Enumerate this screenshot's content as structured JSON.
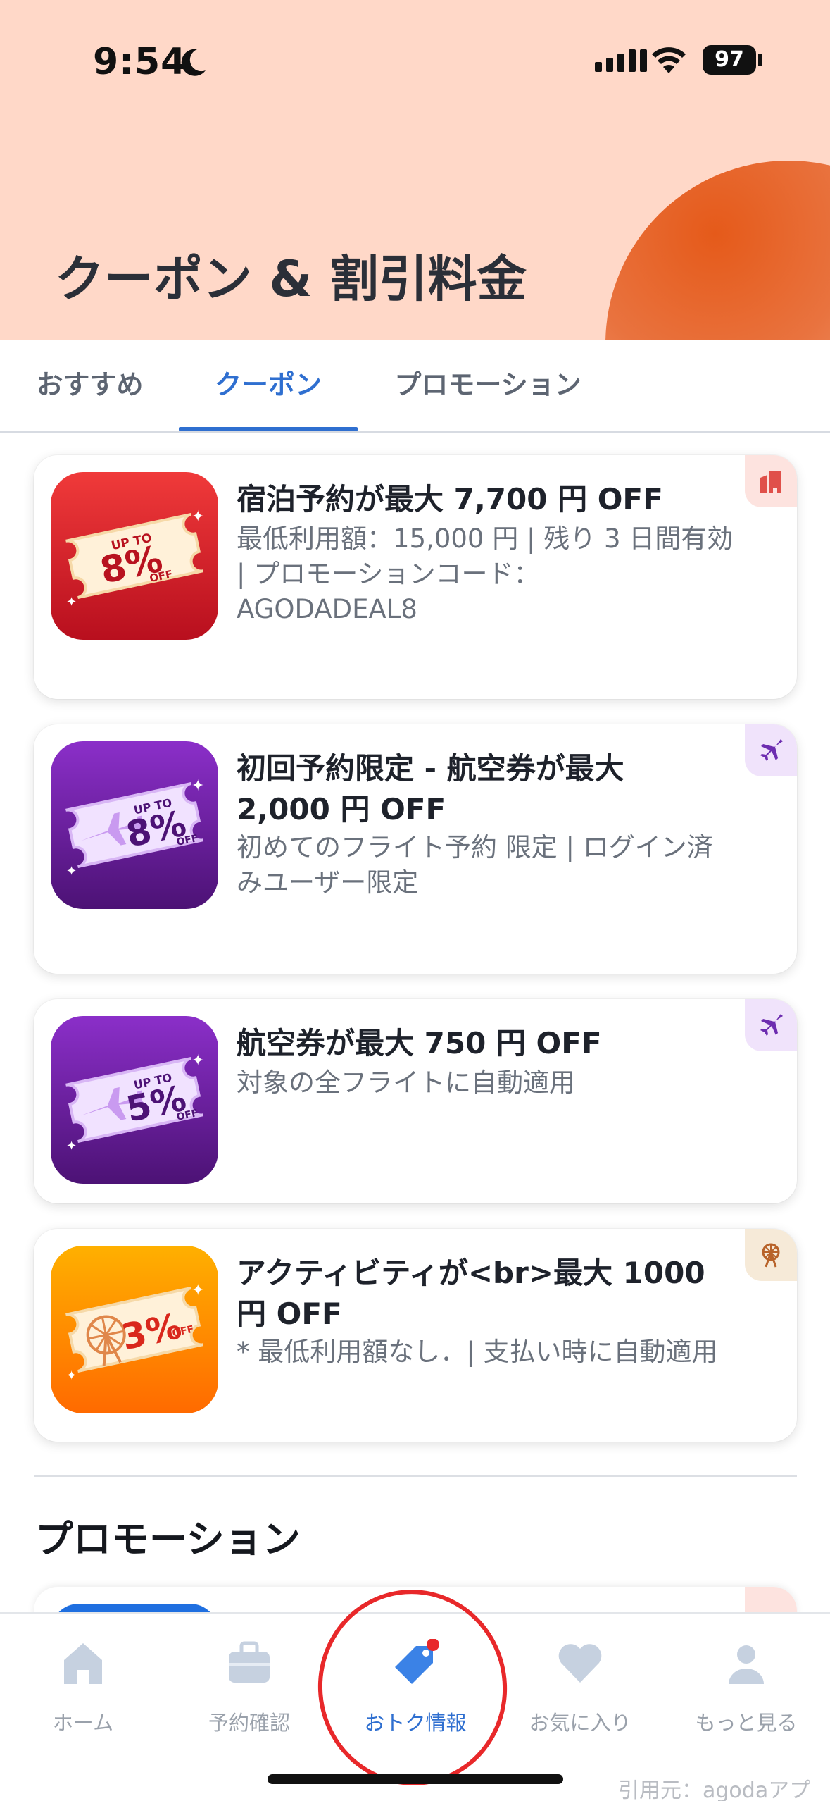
{
  "status_bar": {
    "time": "9:54",
    "battery": "97"
  },
  "header": {
    "title": "クーポン & 割引料金"
  },
  "tabs": [
    {
      "label": "おすすめ",
      "active": false
    },
    {
      "label": "クーポン",
      "active": true
    },
    {
      "label": "プロモーション",
      "active": false
    }
  ],
  "coupons": [
    {
      "title": "宿泊予約が最大 7,700 円 OFF",
      "desc_lines": [
        "最低利用額：15,000 円 | 残り 3 日間有効",
        "| プロモーションコード：",
        "AGODADEAL8"
      ],
      "badge_upto": "UP TO",
      "badge_pct": "8%",
      "badge_off": "OFF",
      "category_icon": "hotel-icon",
      "theme": "#e21c2c"
    },
    {
      "title_lines": [
        "初回予約限定 - 航空券が最大",
        "2,000 円 OFF"
      ],
      "desc_lines": [
        "初めてのフライト予約 限定 | ログイン済",
        "みユーザー限定"
      ],
      "badge_upto": "UP TO",
      "badge_pct": "8%",
      "badge_off": "OFF",
      "category_icon": "plane-icon",
      "theme": "#6d2db0"
    },
    {
      "title": "航空券が最大 750 円 OFF",
      "desc_lines": [
        "対象の全フライトに自動適用"
      ],
      "badge_upto": "UP TO",
      "badge_pct": "5%",
      "badge_off": "OFF",
      "category_icon": "plane-icon",
      "theme": "#6d2db0"
    },
    {
      "title_lines": [
        "アクティビティが<br>最大 1000",
        "円 OFF"
      ],
      "desc_lines": [
        "* 最低利用額なし．| 支払い時に自動適用"
      ],
      "badge_pct": "3%",
      "badge_off": "OFF",
      "category_icon": "ferris-wheel-icon",
      "theme": "#ff8a00"
    }
  ],
  "section": {
    "title": "プロモーション"
  },
  "bottom_nav": [
    {
      "label": "ホーム",
      "icon": "home-icon",
      "active": false
    },
    {
      "label": "予約確認",
      "icon": "suitcase-icon",
      "active": false
    },
    {
      "label": "おトク情報",
      "icon": "tag-icon",
      "active": true
    },
    {
      "label": "お気に入り",
      "icon": "heart-icon",
      "active": false
    },
    {
      "label": "もっと見る",
      "icon": "person-icon",
      "active": false
    }
  ],
  "watermark": "引用元：agodaアプリ",
  "colors": {
    "accent": "#2f6fd0",
    "header_bg": "#ffd8c8",
    "annotation_red": "#e8282a"
  }
}
